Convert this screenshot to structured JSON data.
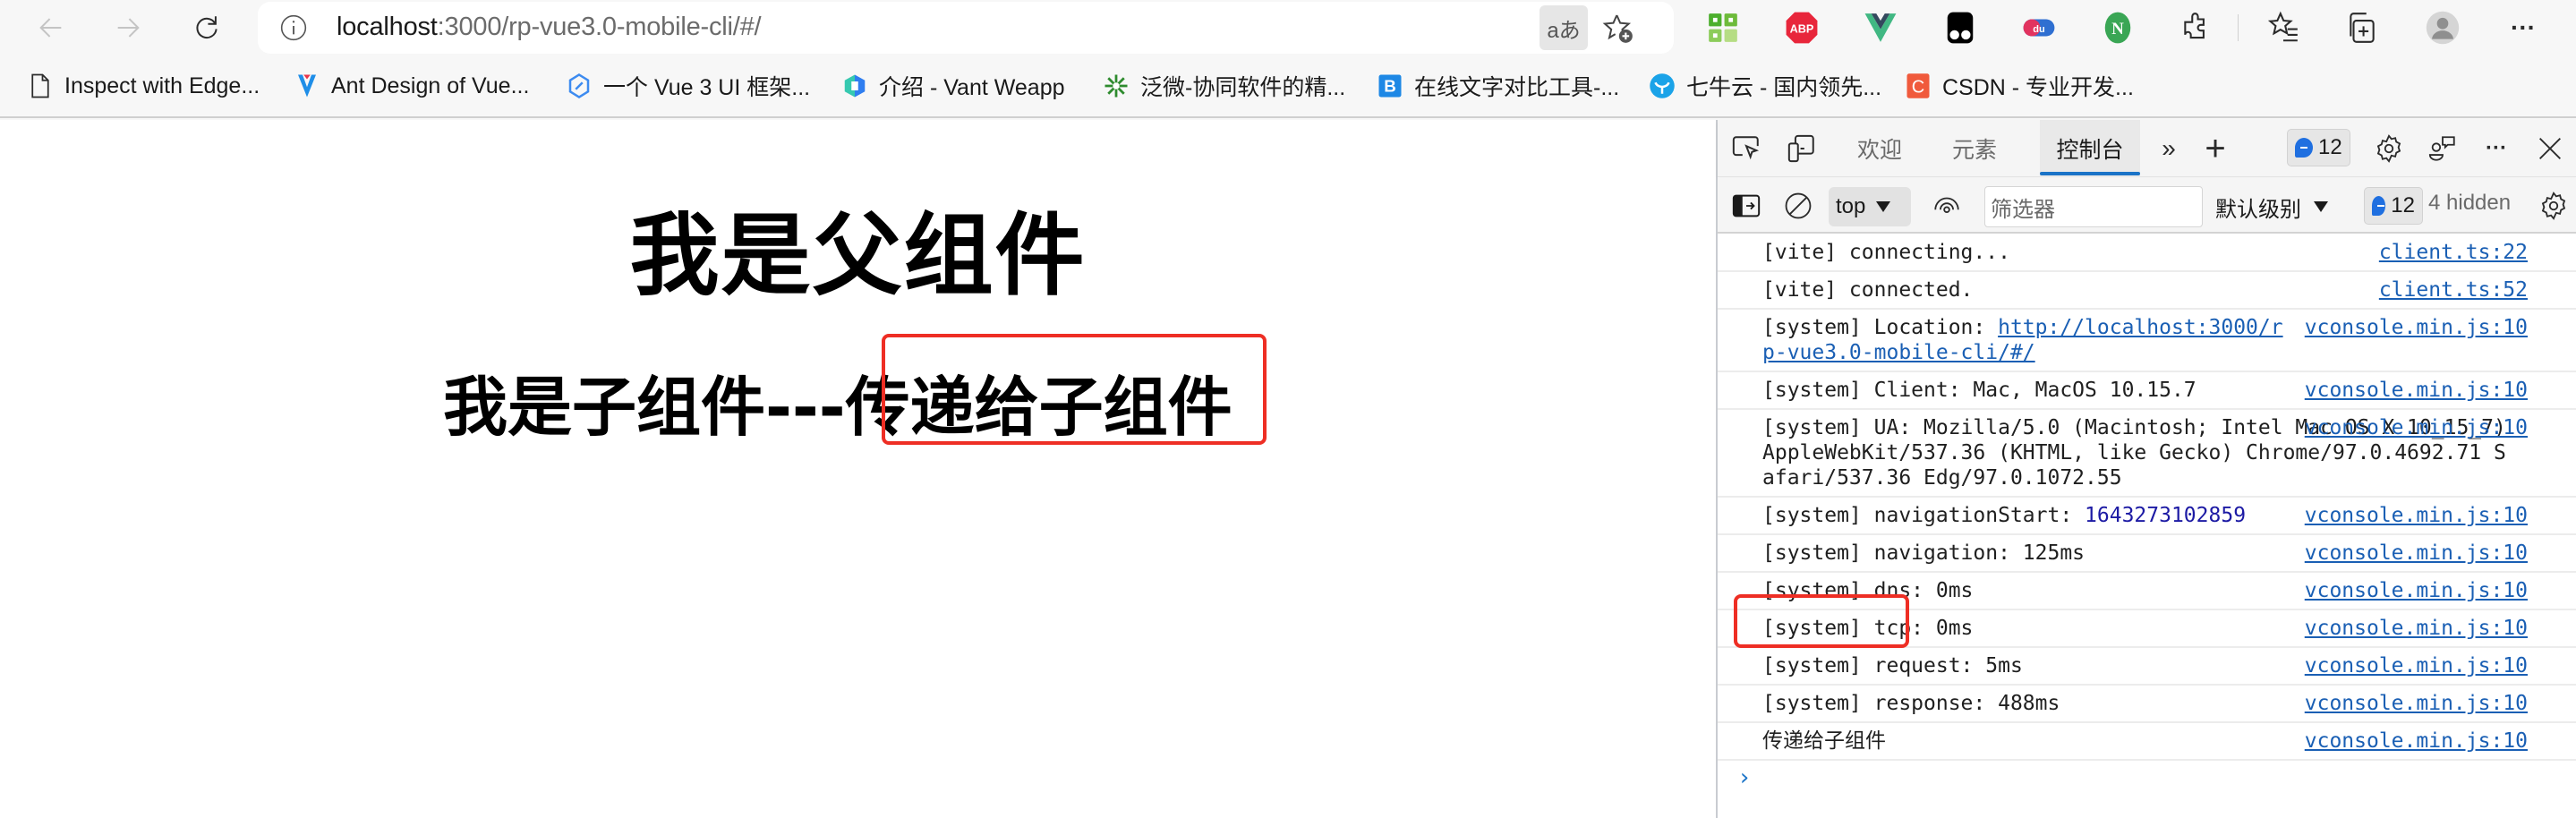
{
  "browser": {
    "url_host": "localhost",
    "url_rest": ":3000/rp-vue3.0-mobile-cli/#/",
    "read_aloud_label": "aあ",
    "extensions": [
      "qr-code-extension-icon",
      "adblock-plus-icon",
      "vue-devtools-icon",
      "tampermonkey-icon",
      "du-extension-icon",
      "nimbus-n-icon",
      "extensions-puzzle-icon"
    ],
    "adblock_label": "ABP",
    "du_label": "du",
    "n_label": "N",
    "more_label": "···"
  },
  "bookmarks": [
    {
      "label": "Inspect with Edge...",
      "icon": "page-icon"
    },
    {
      "label": "Ant Design of Vue...",
      "icon": "ant-design-vue-icon"
    },
    {
      "label": "一个 Vue 3 UI 框架...",
      "icon": "vue3-ui-icon"
    },
    {
      "label": "介绍 - Vant Weapp",
      "icon": "vant-icon"
    },
    {
      "label": "泛微-协同软件的精...",
      "icon": "weaver-icon"
    },
    {
      "label": "在线文字对比工具-...",
      "icon": "text-compare-icon"
    },
    {
      "label": "七牛云 - 国内领先...",
      "icon": "qiniu-icon"
    },
    {
      "label": "CSDN - 专业开发...",
      "icon": "csdn-icon"
    }
  ],
  "page": {
    "parent_title": "我是父组件",
    "child_prefix": "我是子组件---",
    "child_value": "传递给子组件"
  },
  "devtools": {
    "tabs": [
      {
        "label": "欢迎",
        "active": false
      },
      {
        "label": "元素",
        "active": false
      },
      {
        "label": "控制台",
        "active": true
      }
    ],
    "more_tabs": "»",
    "add_tab": "+",
    "issues_count": "12",
    "context": "top",
    "filter_placeholder": "筛选器",
    "level": "默认级别",
    "issues_count_filter": "12",
    "hidden_label": "4 hidden",
    "more_label": "···"
  },
  "console": [
    {
      "text": "[vite] connecting...",
      "source": "client.ts:22"
    },
    {
      "text": "[vite] connected.",
      "source": "client.ts:52"
    },
    {
      "prefix": "[system] Location: ",
      "link": "http://localhost:3000/rp-vue3.0-mobile-cli/#/",
      "source": "vconsole.min.js:10"
    },
    {
      "text": "[system] Client: Mac, MacOS 10.15.7",
      "source": "vconsole.min.js:10"
    },
    {
      "text": "[system] UA: Mozilla/5.0 (Macintosh; Intel Mac OS X 10_15_7) AppleWebKit/537.36 (KHTML, like Gecko) Chrome/97.0.4692.71 Safari/537.36 Edg/97.0.1072.55",
      "source": "vconsole.min.js:10"
    },
    {
      "prefix": "[system] navigationStart: ",
      "number": "1643273102859",
      "source": "vconsole.min.js:10"
    },
    {
      "text": "[system] navigation: 125ms",
      "source": "vconsole.min.js:10"
    },
    {
      "text": "[system] dns: 0ms",
      "source": "vconsole.min.js:10"
    },
    {
      "text": "[system] tcp: 0ms",
      "source": "vconsole.min.js:10"
    },
    {
      "text": "[system] request: 5ms",
      "source": "vconsole.min.js:10"
    },
    {
      "text": "[system] response: 488ms",
      "source": "vconsole.min.js:10"
    },
    {
      "text": "传递给子组件",
      "source": "vconsole.min.js:10"
    }
  ],
  "console_prompt": "›",
  "colors": {
    "highlight": "#ee2e24",
    "link": "#1a5fb4",
    "accent": "#1a73c7",
    "number": "#1c1aa4"
  }
}
